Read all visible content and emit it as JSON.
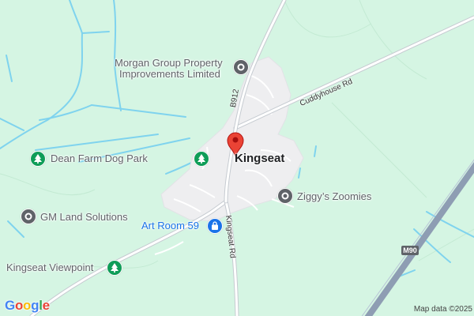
{
  "map": {
    "places": {
      "morgan_line1": "Morgan Group Property",
      "morgan_line2": "Improvements Limited",
      "dean_farm": "Dean Farm Dog Park",
      "gm_land": "GM Land Solutions",
      "kingseat_viewpoint": "Kingseat Viewpoint",
      "art_room": "Art Room 59",
      "ziggys": "Ziggy’s Zoomies",
      "town": "Kingseat"
    },
    "roads": {
      "b912": "B912",
      "cuddyhouse": "Cuddyhouse Rd",
      "kingseat_rd": "Kingseat Rd",
      "m90": "M90"
    },
    "attribution": "Map data ©2025",
    "logo": "Google",
    "colors": {
      "background": "#d5f5e3",
      "urban": "#eeeef0",
      "water": "#7fd3ee",
      "motorway": "#8e9db3",
      "poi_gray": "#5f6368",
      "poi_green": "#0f9d58",
      "poi_blue": "#1a73e8",
      "marker": "#ea4335"
    }
  }
}
